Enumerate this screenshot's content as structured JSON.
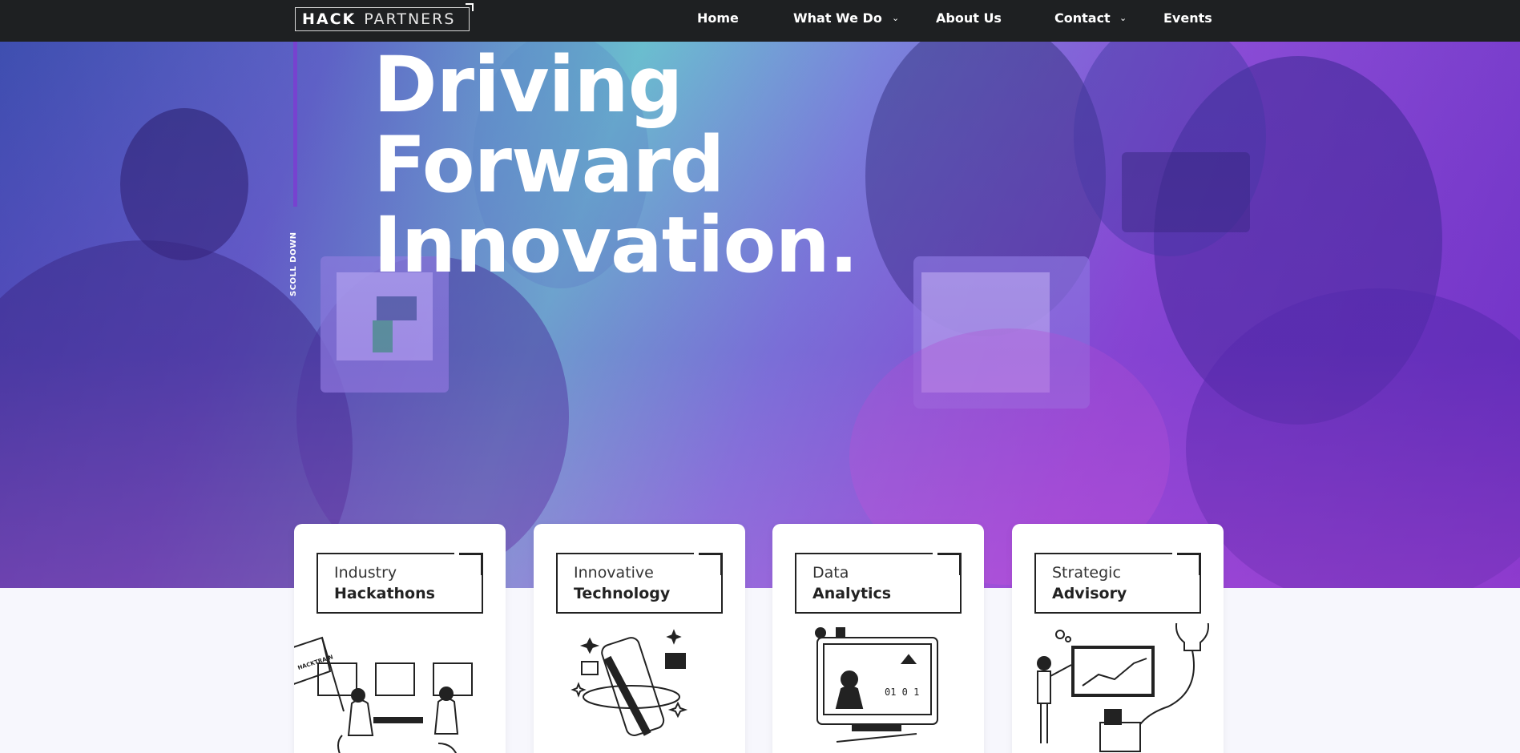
{
  "nav": {
    "logo_bold": "HACK",
    "logo_light": "PARTNERS",
    "items": [
      {
        "label": "Home",
        "has_dropdown": false
      },
      {
        "label": "What We Do",
        "has_dropdown": true
      },
      {
        "label": "About Us",
        "has_dropdown": false
      },
      {
        "label": "Contact",
        "has_dropdown": true
      },
      {
        "label": "Events",
        "has_dropdown": false
      }
    ],
    "chevron_icon": "chevron-down-icon"
  },
  "hero": {
    "headline": [
      "Driving",
      "Forward",
      "Innovation."
    ],
    "scroll_label": "SCOLL DOWN",
    "colors": {
      "accent": "#7a3fd0",
      "gradient_start": "#3b4fae",
      "gradient_mid": "#6ac3cf",
      "gradient_end": "#8a4dd6"
    }
  },
  "cards": [
    {
      "line1": "Industry",
      "line2": "Hackathons",
      "illustration": "hackathon-train-illustration",
      "flag_text": "HACKTRAIN"
    },
    {
      "line1": "Innovative",
      "line2": "Technology",
      "illustration": "smartphone-illustration"
    },
    {
      "line1": "Data",
      "line2": "Analytics",
      "illustration": "data-monitor-illustration"
    },
    {
      "line1": "Strategic",
      "line2": "Advisory",
      "illustration": "advisory-presentation-illustration"
    }
  ]
}
